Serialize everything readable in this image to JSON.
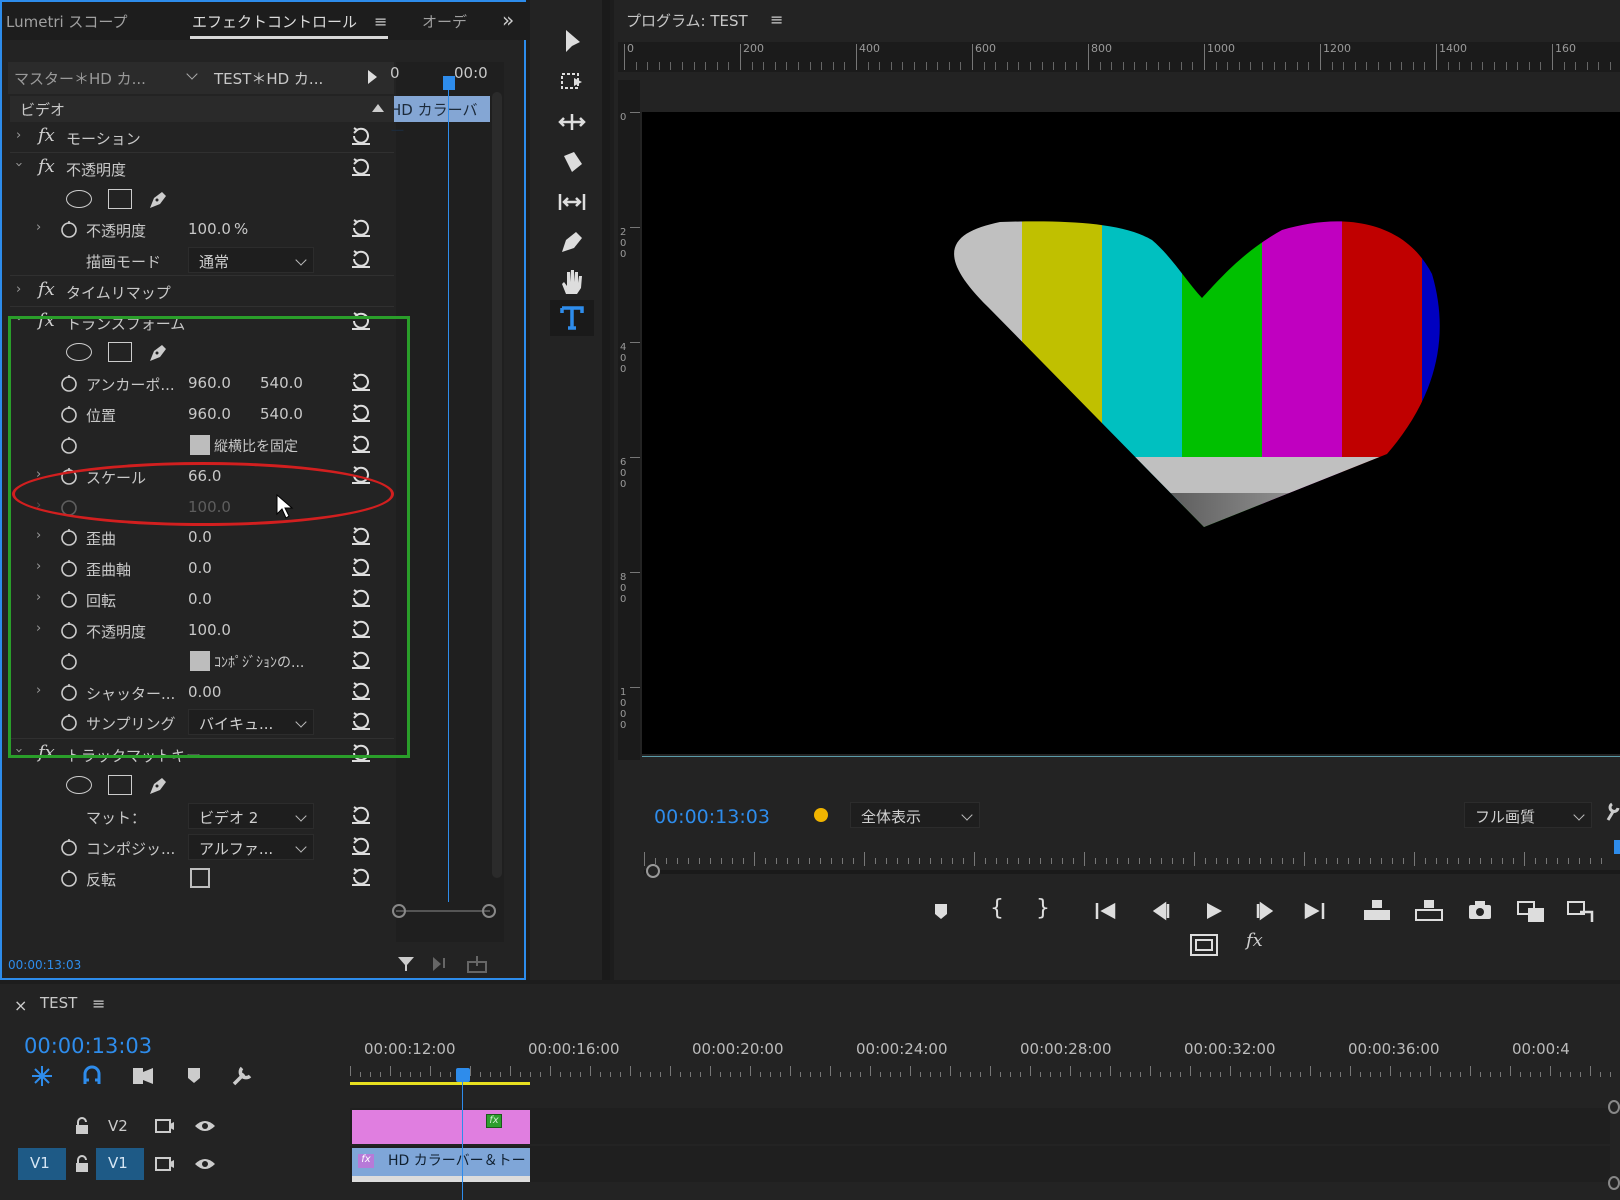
{
  "fx_panel": {
    "tabs": [
      "Lumetri スコープ",
      "エフェクトコントロール",
      "オーデ"
    ],
    "master_label": "マスター＊HD カ...",
    "seq_clip_label": "TEST＊HD カ...",
    "mini_tl_time": "00:0",
    "mini_tl_zero": "0",
    "mini_clip_label": "HD カラーバー",
    "section_video": "ビデオ",
    "motion": "モーション",
    "opacity": "不透明度",
    "opacity_param": "不透明度",
    "opacity_value": "100.0",
    "opacity_unit": "%",
    "blend_mode_label": "描画モード",
    "blend_mode_value": "通常",
    "time_remap": "タイムリマップ",
    "transform": "トランスフォーム",
    "anchor_label": "アンカーポ...",
    "anchor_x": "960.0",
    "anchor_y": "540.0",
    "position_label": "位置",
    "position_x": "960.0",
    "position_y": "540.0",
    "uniform_scale_label": "縦横比を固定",
    "scale_label": "スケール",
    "scale_value": "66.0",
    "scale_width_value": "100.0",
    "skew_label": "歪曲",
    "skew_value": "0.0",
    "skew_axis_label": "歪曲軸",
    "skew_axis_value": "0.0",
    "rotation_label": "回転",
    "rotation_value": "0.0",
    "t_opacity_label": "不透明度",
    "t_opacity_value": "100.0",
    "comp_shutter_label": "ｺﾝﾎﾟｼﾞｼｮﾝの...",
    "shutter_label": "シャッター...",
    "shutter_value": "0.00",
    "sampling_label": "サンプリング",
    "sampling_value": "バイキュ...",
    "track_matte": "トラックマットキー",
    "matte_label": "マット：",
    "matte_value": "ビデオ 2",
    "composite_label": "コンポジッ...",
    "composite_value": "アルファ...",
    "reverse_label": "反転",
    "bottom_timecode": "00:00:13:03"
  },
  "program": {
    "title": "プログラム: TEST",
    "ruler_top": [
      "0",
      "200",
      "400",
      "600",
      "800",
      "1000",
      "1200",
      "1400",
      "160"
    ],
    "ruler_left": [
      "0",
      "2\n0\n0",
      "4\n0\n0",
      "6\n0\n0",
      "8\n0\n0",
      "1\n0\n0\n0"
    ],
    "timecode": "00:00:13:03",
    "fit_label": "全体表示",
    "quality_label": "フル画質"
  },
  "sequence": {
    "title": "TEST",
    "timecode": "00:00:13:03",
    "ruler": [
      "00:00:12:00",
      "00:00:16:00",
      "00:00:20:00",
      "00:00:24:00",
      "00:00:28:00",
      "00:00:32:00",
      "00:00:36:00",
      "00:00:4"
    ],
    "v2_label": "V2",
    "v1_label": "V1",
    "v1_src": "V1",
    "clip_v1_label": "HD カラーバー＆トー",
    "fx_badge": "fx"
  },
  "colors": {
    "accent": "#2e8ceb",
    "green_box": "#2a9e2a",
    "red_ellipse": "#d21f1f",
    "clip_pink": "#e07ee0",
    "clip_blue": "#7fa6d8",
    "work_area": "#e8e020"
  }
}
